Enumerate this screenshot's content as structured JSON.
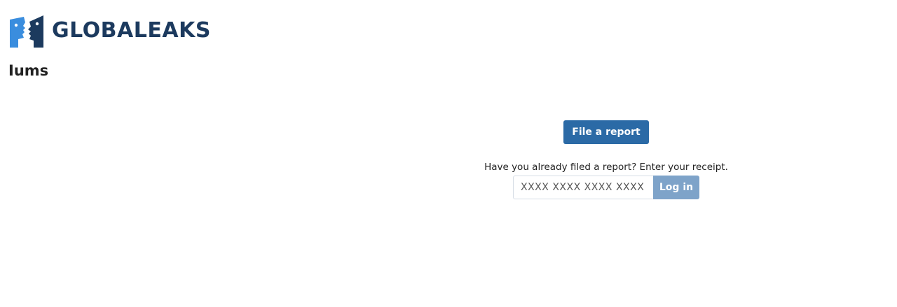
{
  "header": {
    "logo_icon": "globaleaks-two-faces-logo-icon",
    "logo_text": "GLOBALEAKS",
    "logo_colors": {
      "light": "#3a8dde",
      "dark": "#1c3a5e"
    }
  },
  "site": {
    "name": "Iums"
  },
  "main": {
    "file_report_label": "File a report",
    "receipt_prompt": "Have you already filed a report? Enter your receipt.",
    "receipt_placeholder": "XXXX XXXX XXXX XXXX",
    "receipt_value": "",
    "login_label": "Log in"
  },
  "colors": {
    "primary_button": "#2b6aa6",
    "disabled_button": "#7ea3c9",
    "brand_text": "#1c3a5e"
  }
}
